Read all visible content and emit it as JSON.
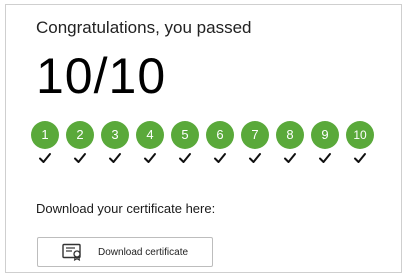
{
  "result": {
    "headline": "Congratulations, you passed",
    "score": "10/10"
  },
  "questions": [
    {
      "number": "1",
      "status": "correct"
    },
    {
      "number": "2",
      "status": "correct"
    },
    {
      "number": "3",
      "status": "correct"
    },
    {
      "number": "4",
      "status": "correct"
    },
    {
      "number": "5",
      "status": "correct"
    },
    {
      "number": "6",
      "status": "correct"
    },
    {
      "number": "7",
      "status": "correct"
    },
    {
      "number": "8",
      "status": "correct"
    },
    {
      "number": "9",
      "status": "correct"
    },
    {
      "number": "10",
      "status": "correct"
    }
  ],
  "certificate": {
    "label": "Download your certificate here:",
    "button_label": "Download certificate",
    "button_icon": "certificate-icon"
  },
  "colors": {
    "correct": "#5aa93a",
    "check": "#111111"
  }
}
